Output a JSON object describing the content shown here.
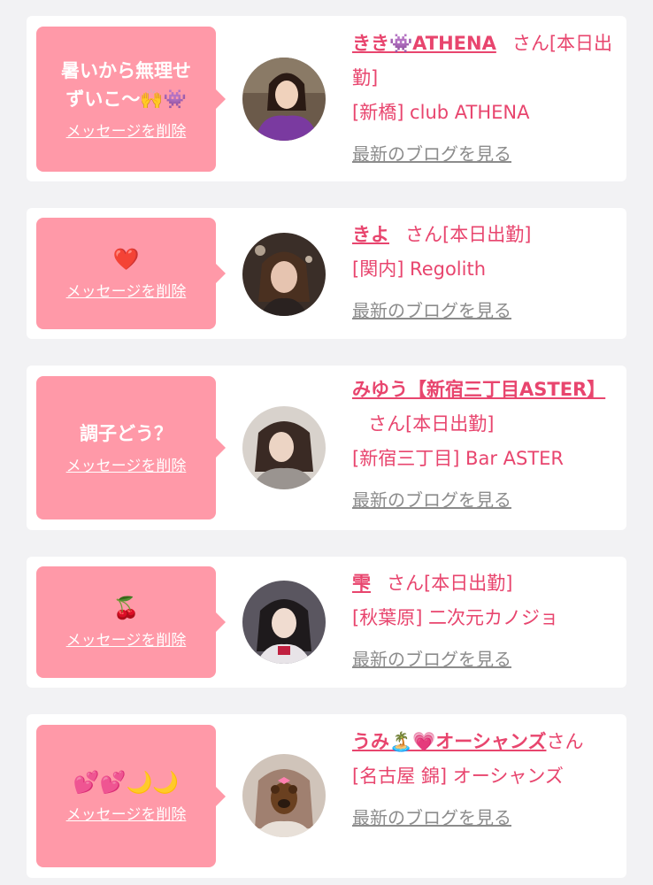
{
  "delete_label": "メッセージを削除",
  "blog_label": "最新のブログを見る",
  "colors": {
    "accent": "#e8456e",
    "bubble": "#ff99a8",
    "card": "#ffffff",
    "bg": "#f2f2f4",
    "link_gray": "#8c8c8c"
  },
  "cards": [
    {
      "message": "暑いから無理せずいこ〜🙌👾",
      "name": "きき👾ATHENA",
      "san_status": "さん[本日出勤]",
      "shop": "[新橋] club ATHENA"
    },
    {
      "message": "❤️",
      "name": "きよ",
      "san_status": "さん[本日出勤]",
      "shop": "[関内] Regolith"
    },
    {
      "message": "調子どう？",
      "name": "みゆう【新宿三丁目ASTER】",
      "san_status": "さん[本日出勤]",
      "shop": "[新宿三丁目] Bar ASTER"
    },
    {
      "message": "🍒",
      "name": "雫",
      "san_status": "さん[本日出勤]",
      "shop": "[秋葉原] 二次元カノジョ"
    },
    {
      "message": "💕💕🌙🌙",
      "name": "うみ🏝️💗オーシャンズ",
      "san_status": "さん",
      "shop": "[名古屋 錦] オーシャンズ"
    }
  ]
}
